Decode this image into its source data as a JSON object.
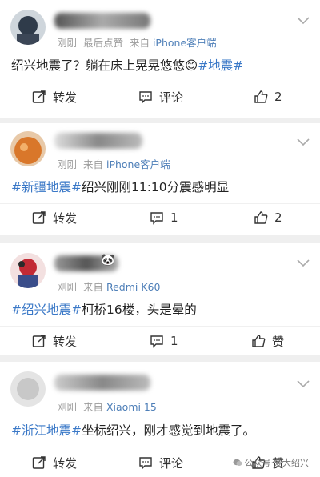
{
  "posts": [
    {
      "meta": {
        "time": "刚刚",
        "extra": "最后点赞",
        "from": "来自",
        "client": "iPhone客户端"
      },
      "text_parts": [
        {
          "t": "绍兴地震了？躺在床上晃晃悠悠",
          "tag": false
        },
        {
          "t": "😊",
          "tag": false
        },
        {
          "t": "#地震#",
          "tag": true
        }
      ],
      "actions": {
        "repost": "转发",
        "comment": "评论",
        "like": "2"
      }
    },
    {
      "meta": {
        "time": "刚刚",
        "extra": "",
        "from": "来自",
        "client": "iPhone客户端"
      },
      "text_parts": [
        {
          "t": "#新疆地震#",
          "tag": true
        },
        {
          "t": "绍兴刚刚11:10分震感明显",
          "tag": false
        }
      ],
      "actions": {
        "repost": "转发",
        "comment": "1",
        "like": "2"
      }
    },
    {
      "meta": {
        "time": "刚刚",
        "extra": "",
        "from": "来自",
        "client": "Redmi K60"
      },
      "text_parts": [
        {
          "t": "#绍兴地震#",
          "tag": true
        },
        {
          "t": "柯桥16楼，头是晕的",
          "tag": false
        }
      ],
      "actions": {
        "repost": "转发",
        "comment": "1",
        "like": "赞"
      }
    },
    {
      "meta": {
        "time": "刚刚",
        "extra": "",
        "from": "来自",
        "client": "Xiaomi 15"
      },
      "text_parts": [
        {
          "t": "#浙江地震#",
          "tag": true
        },
        {
          "t": "坐标绍兴，刚才感觉到地震了。",
          "tag": false
        }
      ],
      "actions": {
        "repost": "转发",
        "comment": "评论",
        "like": "赞"
      }
    }
  ],
  "watermark": "公众号·爱大绍兴"
}
